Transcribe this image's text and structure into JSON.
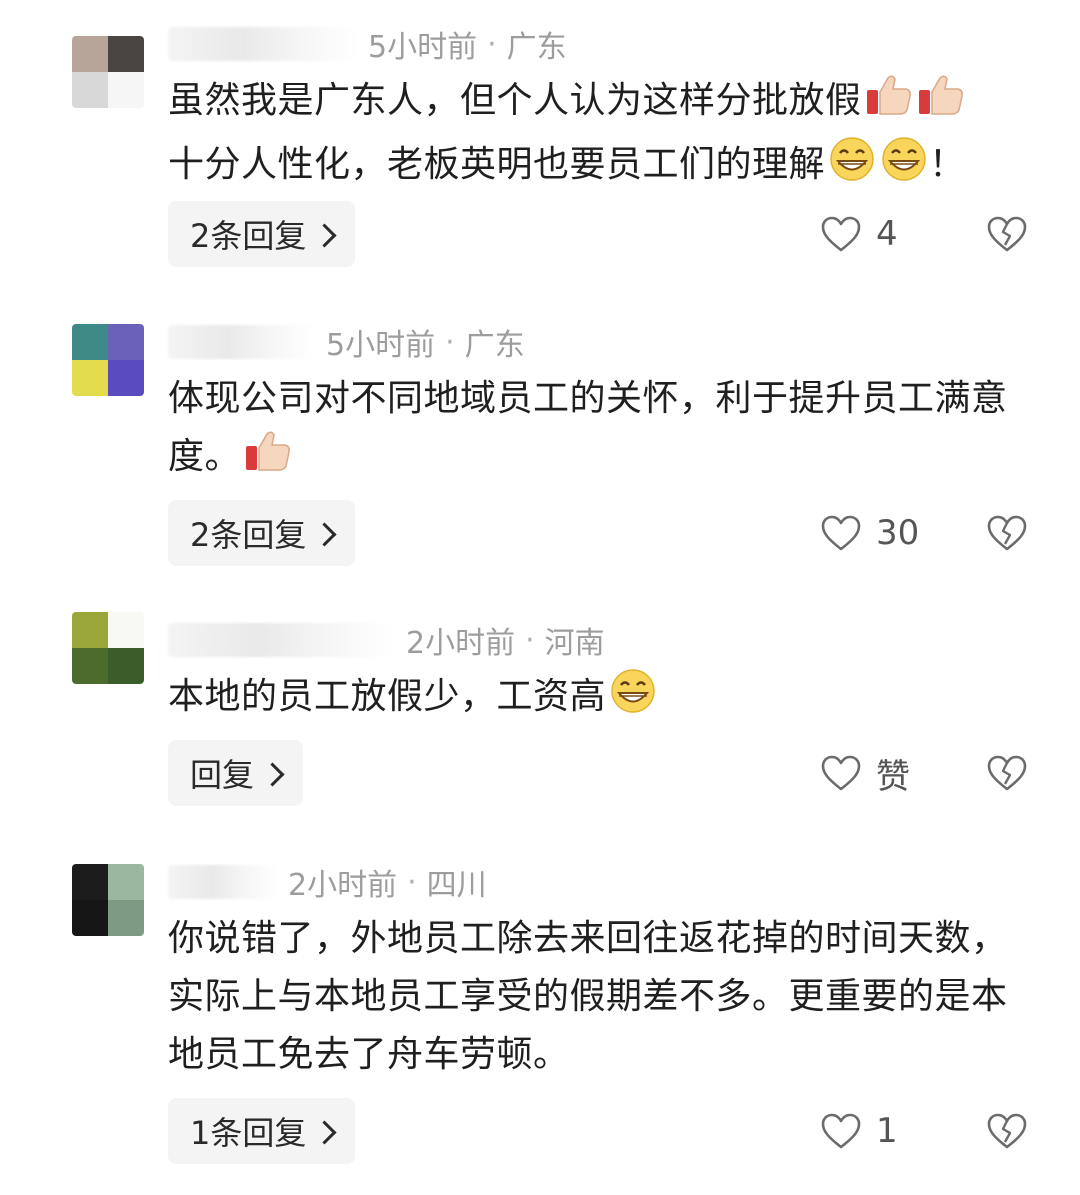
{
  "comments": [
    {
      "time": "5小时前",
      "location": "广东",
      "separator": "·",
      "text_parts": [
        "虽然我是广东人，但个人认为这样分批放假",
        "十分人性化，老板英明也要员工们的理解",
        "！"
      ],
      "emojis": [
        "thumbs-up-icon",
        "thumbs-up-icon",
        "grin-icon",
        "grin-icon"
      ],
      "reply_label": "2条回复",
      "like_count": "4",
      "avatar_colors": [
        "#b8a59a",
        "#4a4542",
        "#d8d8d8",
        "#ffffff"
      ]
    },
    {
      "time": "5小时前",
      "location": "广东",
      "separator": "·",
      "text_parts": [
        "体现公司对不同地域员工的关怀，利于提升员工满意度。"
      ],
      "emojis": [
        "thumbs-up-icon"
      ],
      "reply_label": "2条回复",
      "like_count": "30",
      "avatar_colors": [
        "#3e8a86",
        "#6a62b9",
        "#e3dc4c",
        "#5a4bc0"
      ]
    },
    {
      "time": "2小时前",
      "location": "河南",
      "separator": "·",
      "text_parts": [
        "本地的员工放假少，工资高"
      ],
      "emojis": [
        "grin-icon"
      ],
      "reply_label": "回复",
      "like_count": "赞",
      "avatar_colors": [
        "#9aa63a",
        "#ffffff",
        "#4d6b2c",
        "#3b5d2a"
      ]
    },
    {
      "time": "2小时前",
      "location": "四川",
      "separator": "·",
      "text_parts": [
        "你说错了，外地员工除去来回往返花掉的时间天数，实际上与本地员工享受的假期差不多。更重要的是本地员工免去了舟车劳顿。"
      ],
      "emojis": [],
      "reply_label": "1条回复",
      "like_count": "1",
      "avatar_colors": [
        "#1c1c1c",
        "#9ab8a0",
        "#161616",
        "#7c9a84"
      ]
    }
  ],
  "colors": {
    "meta_text": "#9d9d9d",
    "body_text": "#1f1f1f",
    "reply_bg": "#f4f4f4"
  }
}
